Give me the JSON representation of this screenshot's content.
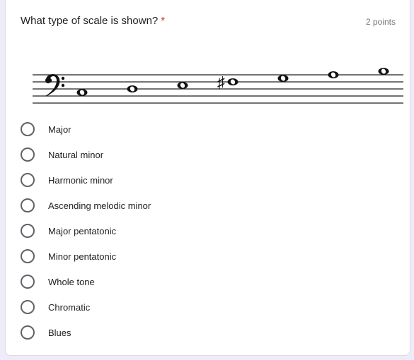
{
  "question": {
    "title": "What type of scale is shown?",
    "required_marker": "*",
    "points": "2 points"
  },
  "staff": {
    "clef": "bass-clef",
    "notes": [
      {
        "position": "C3",
        "accidental": ""
      },
      {
        "position": "D3",
        "accidental": ""
      },
      {
        "position": "E3",
        "accidental": ""
      },
      {
        "position": "F3",
        "accidental": "sharp"
      },
      {
        "position": "G3",
        "accidental": ""
      },
      {
        "position": "A3",
        "accidental": ""
      },
      {
        "position": "B3",
        "accidental": ""
      }
    ]
  },
  "options": [
    {
      "label": "Major"
    },
    {
      "label": "Natural minor"
    },
    {
      "label": "Harmonic minor"
    },
    {
      "label": "Ascending melodic minor"
    },
    {
      "label": "Major pentatonic"
    },
    {
      "label": "Minor pentatonic"
    },
    {
      "label": "Whole tone"
    },
    {
      "label": "Chromatic"
    },
    {
      "label": "Blues"
    }
  ],
  "colors": {
    "background": "#f0ebf8",
    "required": "#d93025",
    "text": "#202124",
    "muted": "#70757a"
  }
}
